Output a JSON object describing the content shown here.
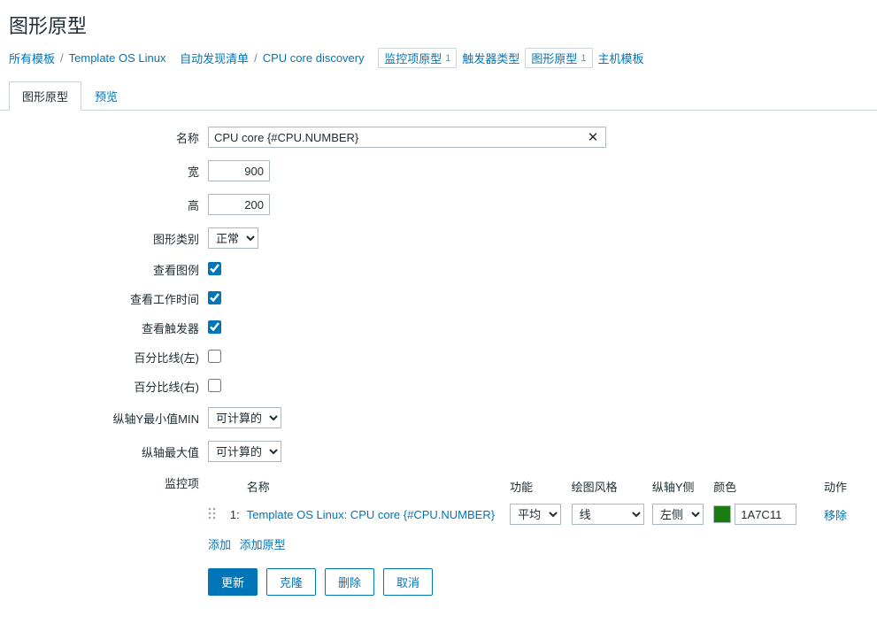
{
  "page": {
    "title": "图形原型"
  },
  "breadcrumb": {
    "all_templates": "所有模板",
    "template_name": "Template OS Linux",
    "discovery_list": "自动发现清单",
    "discovery_rule": "CPU core discovery",
    "item_proto": "监控项原型",
    "item_proto_count": "1",
    "trigger_type": "触发器类型",
    "graph_proto": "图形原型",
    "graph_proto_count": "1",
    "host_templates": "主机模板"
  },
  "tabs": {
    "graph_proto": "图形原型",
    "preview": "预览"
  },
  "labels": {
    "name": "名称",
    "width": "宽",
    "height": "高",
    "graph_type": "图形类别",
    "show_legend": "查看图例",
    "show_working_time": "查看工作时间",
    "show_triggers": "查看触发器",
    "percent_left": "百分比线(左)",
    "percent_right": "百分比线(右)",
    "yaxis_min": "纵轴Y最小值MIN",
    "yaxis_max": "纵轴最大值",
    "items": "监控项"
  },
  "values": {
    "name": "CPU core {#CPU.NUMBER}",
    "width": "900",
    "height": "200",
    "graph_type": "正常",
    "show_legend": true,
    "show_working_time": true,
    "show_triggers": true,
    "percent_left": false,
    "percent_right": false,
    "yaxis_min": "可计算的",
    "yaxis_max": "可计算的"
  },
  "items_table": {
    "headers": {
      "name": "名称",
      "function": "功能",
      "draw_style": "绘图风格",
      "yaxis_side": "纵轴Y侧",
      "color": "颜色",
      "action": "动作"
    },
    "rows": [
      {
        "index": "1:",
        "name": "Template OS Linux: CPU core {#CPU.NUMBER}",
        "function": "平均",
        "draw_style": "线",
        "yaxis_side": "左侧",
        "color": "1A7C11",
        "remove": "移除"
      }
    ],
    "add": "添加",
    "add_proto": "添加原型"
  },
  "buttons": {
    "update": "更新",
    "clone": "克隆",
    "delete": "删除",
    "cancel": "取消"
  }
}
